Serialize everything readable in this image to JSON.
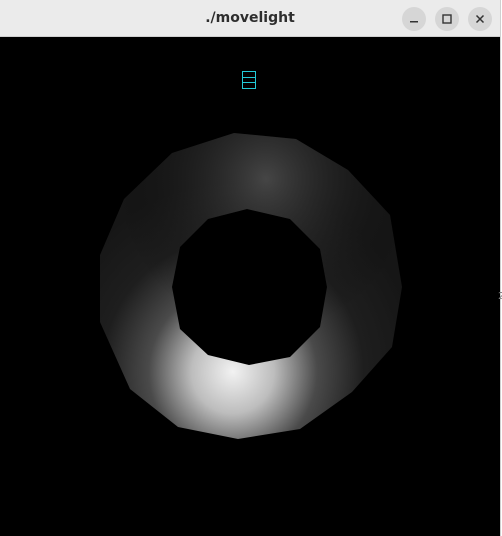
{
  "window": {
    "title": "./movelight",
    "controls": {
      "minimize_icon": "minimize-icon",
      "maximize_icon": "maximize-icon",
      "close_icon": "close-icon"
    }
  },
  "scene": {
    "background": "#000000",
    "light_marker_color": "#22c9d6",
    "torus_shade_color": "#1b1b1b",
    "torus_highlight_color": "#f2f2f2"
  },
  "edge_glyph": "2"
}
